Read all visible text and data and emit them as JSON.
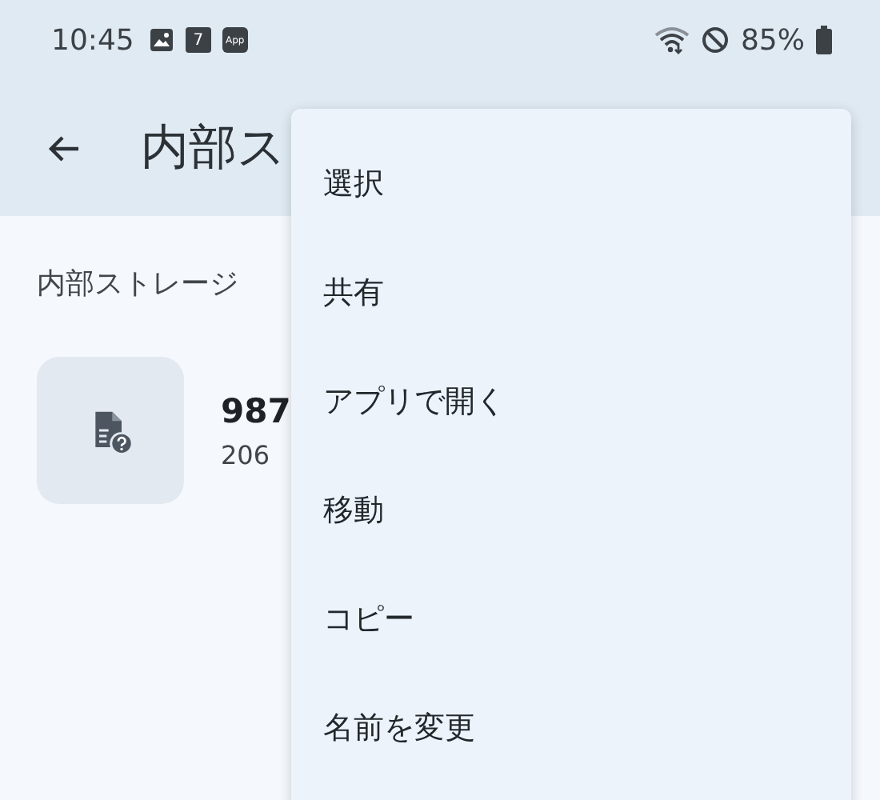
{
  "status_bar": {
    "time": "10:45",
    "calendar_day": "7",
    "app_badge": "App",
    "battery": "85%"
  },
  "app_bar": {
    "title": "内部ス"
  },
  "location": "内部ストレージ",
  "file": {
    "name": "987",
    "size": "206"
  },
  "menu": [
    {
      "label": "選択"
    },
    {
      "label": "共有"
    },
    {
      "label": "アプリで開く"
    },
    {
      "label": "移動"
    },
    {
      "label": "コピー"
    },
    {
      "label": "名前を変更"
    }
  ]
}
